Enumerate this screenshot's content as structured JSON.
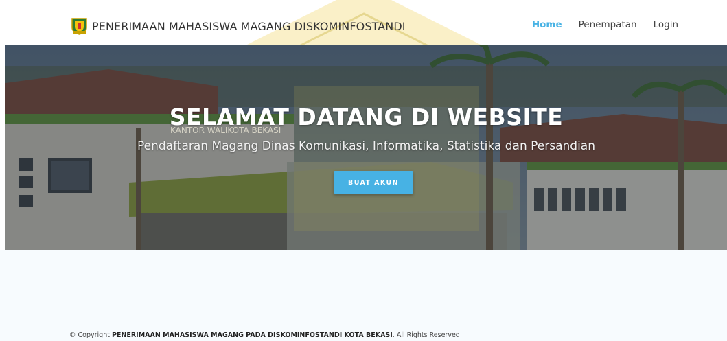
{
  "header": {
    "brand": "PENERIMAAN MAHASISWA MAGANG DISKOMINFOSTANDI",
    "logo_icon": "bekasi-crest-icon"
  },
  "nav": {
    "items": [
      {
        "label": "Home",
        "active": true
      },
      {
        "label": "Penempatan",
        "active": false
      },
      {
        "label": "Login",
        "active": false
      }
    ]
  },
  "hero": {
    "title": "SELAMAT DATANG DI WEBSITE",
    "subtitle": "Pendaftaran Magang Dinas Komunikasi, Informatika, Statistika dan Persandian",
    "button_label": "BUAT AKUN",
    "sign_text": "KANTOR WALIKOTA BEKASI"
  },
  "footer": {
    "prefix": "© Copyright ",
    "org": "PENERIMAAN MAHASISWA MAGANG PADA DISKOMINFOSTANDI KOTA BEKASI",
    "suffix": ". All Rights Reserved"
  },
  "colors": {
    "accent": "#47b2e4",
    "text": "#444444"
  }
}
